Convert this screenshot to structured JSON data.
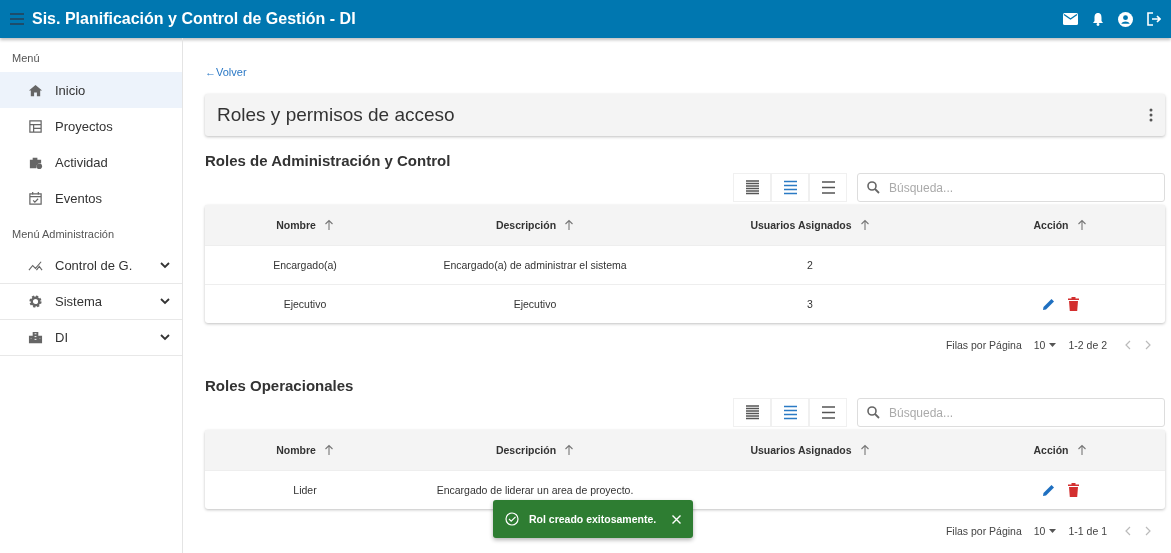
{
  "app_bar": {
    "title": "Sis. Planificación y Control de Gestión - DI"
  },
  "sidebar": {
    "sections": [
      {
        "heading": "Menú",
        "items": [
          {
            "label": "Inicio",
            "selected": true,
            "expandable": false
          },
          {
            "label": "Proyectos",
            "selected": false,
            "expandable": false
          },
          {
            "label": "Actividad",
            "selected": false,
            "expandable": false
          },
          {
            "label": "Eventos",
            "selected": false,
            "expandable": false
          }
        ]
      },
      {
        "heading": "Menú Administración",
        "items": [
          {
            "label": "Control de G.",
            "selected": false,
            "expandable": true
          },
          {
            "label": "Sistema",
            "selected": false,
            "expandable": true
          },
          {
            "label": "DI",
            "selected": false,
            "expandable": true
          }
        ]
      }
    ]
  },
  "back_link": "←Volver",
  "page_title": "Roles y permisos de acceso",
  "tables": [
    {
      "title": "Roles de Administración y Control",
      "density": [
        {
          "selected": false
        },
        {
          "selected": true
        },
        {
          "selected": false
        }
      ],
      "search": {
        "placeholder": "Búsqueda..."
      },
      "columns": [
        "Nombre",
        "Descripción",
        "Usuarios Asignados",
        "Acción"
      ],
      "rows": [
        {
          "name": "Encargado(a)",
          "description": "Encargado(a) de administrar el sistema",
          "users": "2",
          "actions": false
        },
        {
          "name": "Ejecutivo",
          "description": "Ejecutivo",
          "users": "3",
          "actions": true
        }
      ],
      "pagination": {
        "rows_label": "Filas por Página",
        "rows_per_page": "10",
        "range": "1-2 de 2"
      }
    },
    {
      "title": "Roles Operacionales",
      "density": [
        {
          "selected": false
        },
        {
          "selected": true
        },
        {
          "selected": false
        }
      ],
      "search": {
        "placeholder": "Búsqueda..."
      },
      "columns": [
        "Nombre",
        "Descripción",
        "Usuarios Asignados",
        "Acción"
      ],
      "rows": [
        {
          "name": "Lider",
          "description": "Encargado de liderar un area de proyecto.",
          "actions": true
        }
      ],
      "pagination": {
        "rows_label": "Filas por Página",
        "rows_per_page": "10",
        "range": "1-1 de 1"
      }
    }
  ],
  "toast": {
    "message": "Rol creado exitosamente."
  }
}
